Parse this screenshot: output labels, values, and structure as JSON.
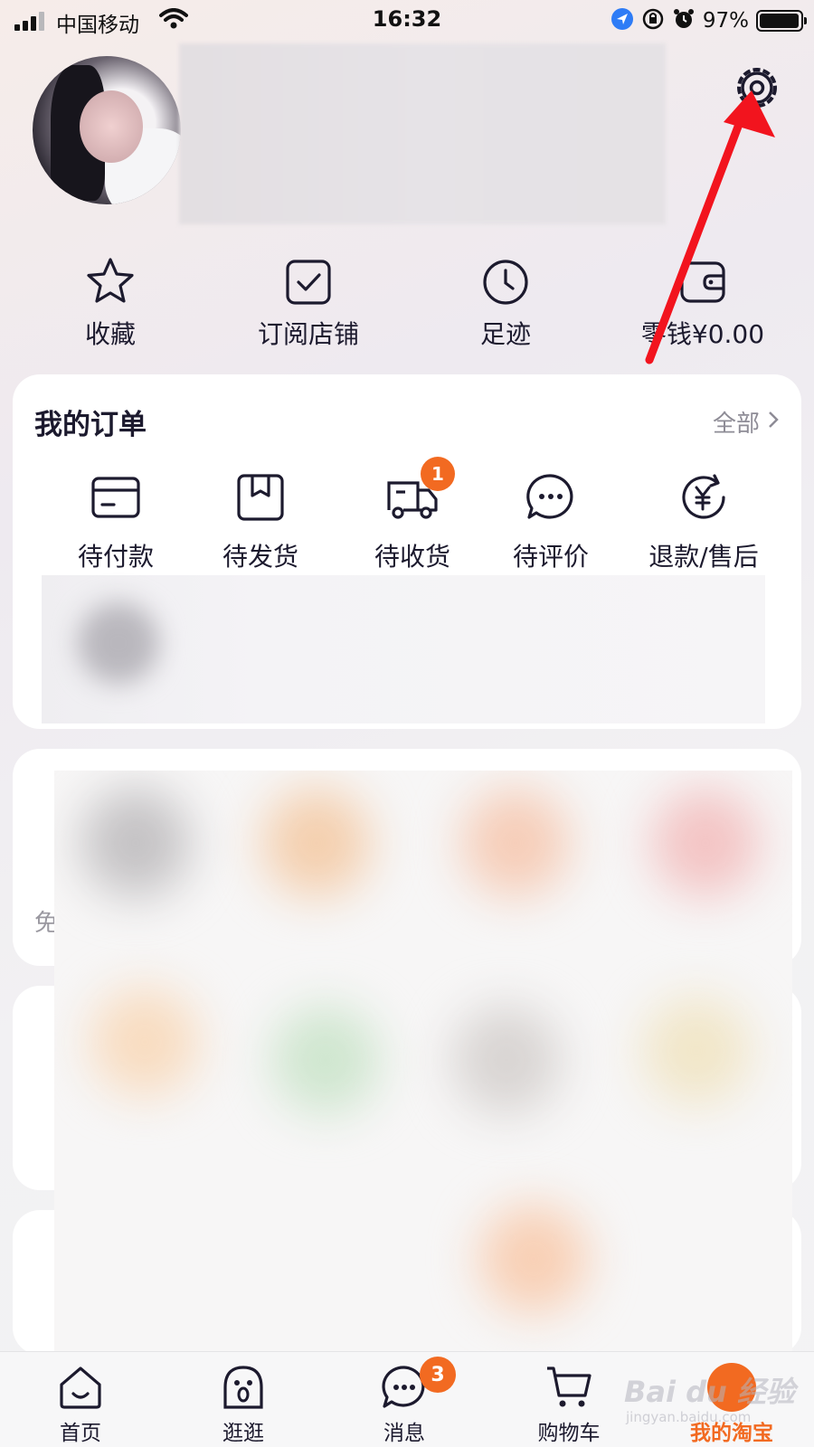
{
  "status_bar": {
    "carrier": "中国移动",
    "time": "16:32",
    "battery": "97%",
    "battery_level": 0.97
  },
  "profile": {
    "settings_icon": "gear-icon"
  },
  "shortcuts": [
    {
      "label": "收藏",
      "icon": "star-icon"
    },
    {
      "label": "订阅店铺",
      "icon": "subscribed-check-icon"
    },
    {
      "label": "足迹",
      "icon": "clock-icon"
    },
    {
      "label": "零钱¥0.00",
      "icon": "wallet-icon"
    }
  ],
  "orders": {
    "title": "我的订单",
    "all_label": "全部",
    "items": [
      {
        "label": "待付款",
        "icon": "card-icon"
      },
      {
        "label": "待发货",
        "icon": "box-icon"
      },
      {
        "label": "待收货",
        "icon": "truck-icon",
        "badge": "1"
      },
      {
        "label": "待评价",
        "icon": "chat-dots-icon"
      },
      {
        "label": "退款/售后",
        "icon": "refund-yen-icon"
      }
    ]
  },
  "card2": {
    "partial_text": "免"
  },
  "tab_bar": {
    "tabs": [
      {
        "label": "首页",
        "icon": "home-icon"
      },
      {
        "label": "逛逛",
        "icon": "explore-icon"
      },
      {
        "label": "消息",
        "icon": "message-icon",
        "badge": "3"
      },
      {
        "label": "购物车",
        "icon": "cart-icon"
      },
      {
        "label": "我的淘宝",
        "icon": "me-icon",
        "active": true
      }
    ]
  },
  "watermark": {
    "text": "Bai du 经验",
    "sub": "jingyan.baidu.com"
  },
  "colors": {
    "accent": "#f26a21",
    "annotation_arrow": "#f2141e",
    "icon_stroke": "#1c1a2e"
  }
}
